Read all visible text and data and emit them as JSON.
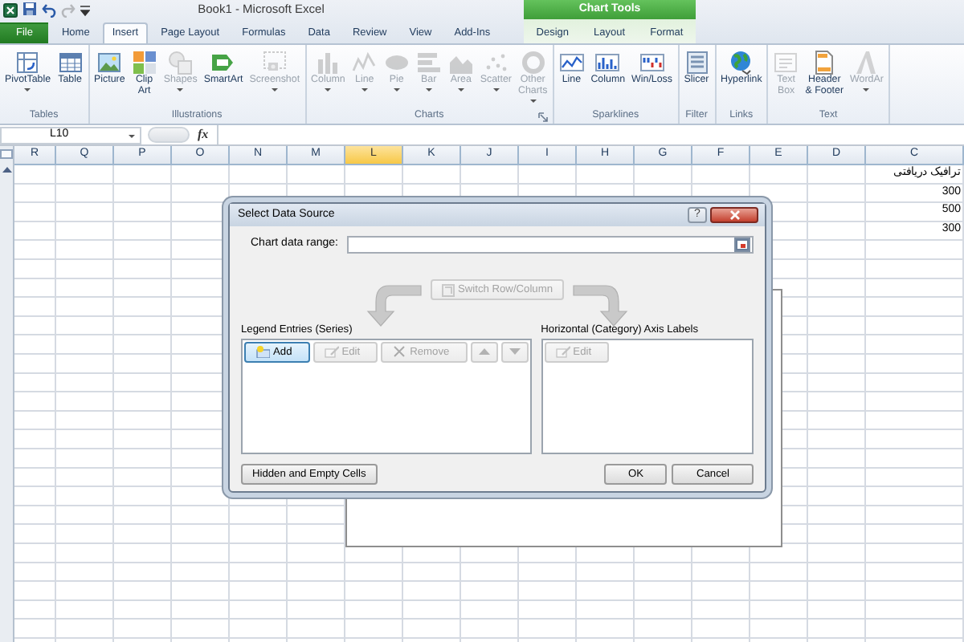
{
  "window": {
    "title": "Book1 - Microsoft Excel"
  },
  "quick_access": [
    {
      "kind": "save",
      "disabled": false
    },
    {
      "kind": "undo",
      "disabled": false
    },
    {
      "kind": "redo",
      "disabled": true
    }
  ],
  "tabs": [
    {
      "label": "File",
      "kind": "file",
      "selected": false
    },
    {
      "label": "Home",
      "kind": "tab",
      "selected": false
    },
    {
      "label": "Insert",
      "kind": "tab",
      "selected": true
    },
    {
      "label": "Page Layout",
      "kind": "tab",
      "selected": false
    },
    {
      "label": "Formulas",
      "kind": "tab",
      "selected": false
    },
    {
      "label": "Data",
      "kind": "tab",
      "selected": false
    },
    {
      "label": "Review",
      "kind": "tab",
      "selected": false
    },
    {
      "label": "View",
      "kind": "tab",
      "selected": false
    },
    {
      "label": "Add-Ins",
      "kind": "tab",
      "selected": false
    }
  ],
  "contextual_tabs": {
    "label": "Chart Tools",
    "tabs": [
      {
        "label": "Design",
        "selected": false
      },
      {
        "label": "Layout",
        "selected": false
      },
      {
        "label": "Format",
        "selected": false
      }
    ]
  },
  "ribbon_groups": [
    {
      "label": "Tables",
      "launcher": false,
      "buttons": [
        {
          "lines": [
            "PivotTable"
          ],
          "dropdown": true,
          "disabled": false
        },
        {
          "lines": [
            "Table"
          ],
          "dropdown": false,
          "disabled": false
        }
      ]
    },
    {
      "label": "Illustrations",
      "launcher": false,
      "buttons": [
        {
          "lines": [
            "Picture"
          ],
          "dropdown": false,
          "disabled": false
        },
        {
          "lines": [
            "Clip",
            "Art"
          ],
          "dropdown": false,
          "disabled": false
        },
        {
          "lines": [
            "Shapes"
          ],
          "dropdown": true,
          "disabled": true
        },
        {
          "lines": [
            "SmartArt"
          ],
          "dropdown": false,
          "disabled": false
        },
        {
          "lines": [
            "Screenshot"
          ],
          "dropdown": true,
          "disabled": true
        }
      ]
    },
    {
      "label": "Charts",
      "launcher": true,
      "buttons": [
        {
          "lines": [
            "Column"
          ],
          "dropdown": true,
          "disabled": true
        },
        {
          "lines": [
            "Line"
          ],
          "dropdown": true,
          "disabled": true
        },
        {
          "lines": [
            "Pie"
          ],
          "dropdown": true,
          "disabled": true
        },
        {
          "lines": [
            "Bar"
          ],
          "dropdown": true,
          "disabled": true
        },
        {
          "lines": [
            "Area"
          ],
          "dropdown": true,
          "disabled": true
        },
        {
          "lines": [
            "Scatter"
          ],
          "dropdown": true,
          "disabled": true
        },
        {
          "lines": [
            "Other",
            "Charts"
          ],
          "dropdown": true,
          "disabled": true
        }
      ]
    },
    {
      "label": "Sparklines",
      "launcher": false,
      "buttons": [
        {
          "lines": [
            "Line"
          ],
          "dropdown": false,
          "disabled": false
        },
        {
          "lines": [
            "Column"
          ],
          "dropdown": false,
          "disabled": false
        },
        {
          "lines": [
            "Win/Loss"
          ],
          "dropdown": false,
          "disabled": false
        }
      ]
    },
    {
      "label": "Filter",
      "launcher": false,
      "buttons": [
        {
          "lines": [
            "Slicer"
          ],
          "dropdown": false,
          "disabled": false
        }
      ]
    },
    {
      "label": "Links",
      "launcher": false,
      "buttons": [
        {
          "lines": [
            "Hyperlink"
          ],
          "dropdown": false,
          "disabled": false
        }
      ]
    },
    {
      "label": "Text",
      "launcher": false,
      "buttons": [
        {
          "lines": [
            "Text",
            "Box"
          ],
          "dropdown": false,
          "disabled": true
        },
        {
          "lines": [
            "Header",
            "& Footer"
          ],
          "dropdown": false,
          "disabled": false
        },
        {
          "lines": [
            "WordAr"
          ],
          "dropdown": true,
          "disabled": true
        }
      ]
    }
  ],
  "formula_bar": {
    "name_box": "L10",
    "function_label": "fx"
  },
  "columns": [
    {
      "label": "R",
      "selected": false
    },
    {
      "label": "Q",
      "selected": false
    },
    {
      "label": "P",
      "selected": false
    },
    {
      "label": "O",
      "selected": false
    },
    {
      "label": "N",
      "selected": false
    },
    {
      "label": "M",
      "selected": false
    },
    {
      "label": "L",
      "selected": true
    },
    {
      "label": "K",
      "selected": false
    },
    {
      "label": "J",
      "selected": false
    },
    {
      "label": "I",
      "selected": false
    },
    {
      "label": "H",
      "selected": false
    },
    {
      "label": "G",
      "selected": false
    },
    {
      "label": "F",
      "selected": false
    },
    {
      "label": "E",
      "selected": false
    },
    {
      "label": "D",
      "selected": false
    },
    {
      "label": "C",
      "selected": false
    }
  ],
  "column_c_cells": [
    "ترافیک دریافتی",
    "300",
    "500",
    "300"
  ],
  "dialog": {
    "title": "Select Data Source",
    "help_button": "?",
    "chart_data_range": {
      "label": "Chart data range:"
    },
    "switch_button": {
      "label": "Switch Row/Column",
      "disabled": true
    },
    "legend_entries": {
      "label": "Legend Entries (Series)",
      "buttons": [
        {
          "kind": "add",
          "label": "Add",
          "disabled": false,
          "highlighted": true
        },
        {
          "kind": "edit",
          "label": "Edit",
          "disabled": true,
          "highlighted": false
        },
        {
          "kind": "remove",
          "label": "Remove",
          "disabled": true,
          "highlighted": false
        },
        {
          "kind": "up",
          "disabled": true,
          "highlighted": false
        },
        {
          "kind": "down",
          "disabled": true,
          "highlighted": false
        }
      ]
    },
    "axis_labels": {
      "label": "Horizontal (Category) Axis Labels",
      "buttons": [
        {
          "kind": "edit",
          "label": "Edit",
          "disabled": true,
          "highlighted": false
        }
      ]
    },
    "buttons": [
      {
        "label": "Hidden and Empty Cells"
      },
      {
        "label": "OK"
      },
      {
        "label": "Cancel"
      }
    ]
  }
}
